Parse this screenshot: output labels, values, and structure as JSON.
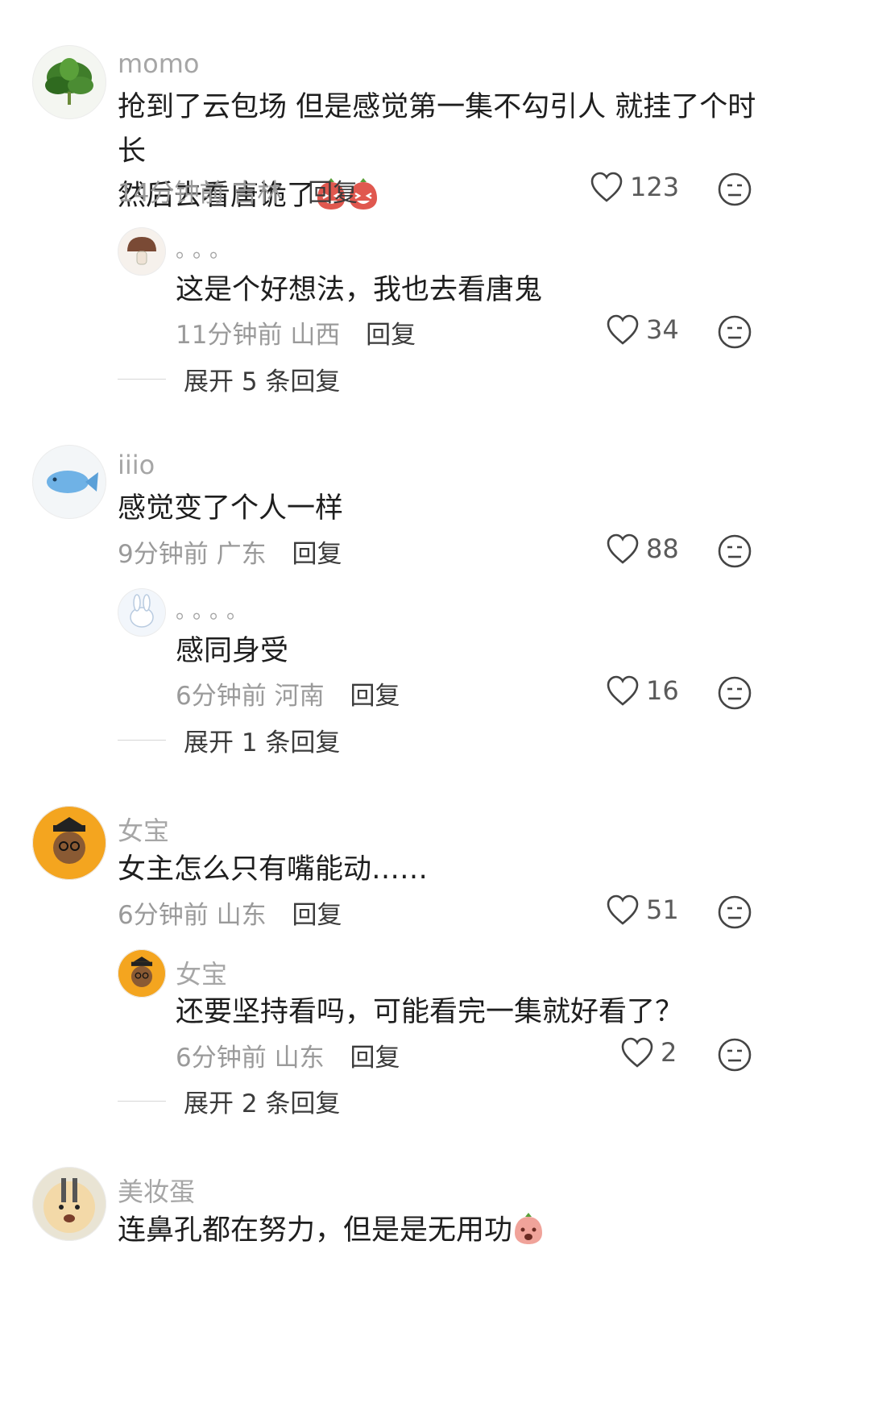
{
  "comments": [
    {
      "user": "momo",
      "text_line1": "抢到了云包场 但是感觉第一集不勾引人 就挂了个时长",
      "text_line2": "然后去看唐诡了",
      "time": "14分钟前",
      "location": "吉林",
      "reply_label": "回复",
      "likes": "123",
      "avatar_icon": "basil-leaf-avatar",
      "reply": {
        "user": "。。。",
        "text": "这是个好想法，我也去看唐鬼",
        "time": "11分钟前",
        "location": "山西",
        "reply_label": "回复",
        "likes": "34",
        "avatar_icon": "mushroom-avatar"
      },
      "expand_label": "展开 5 条回复"
    },
    {
      "user": "iiio",
      "text_line1": "感觉变了个人一样",
      "time": "9分钟前",
      "location": "广东",
      "reply_label": "回复",
      "likes": "88",
      "avatar_icon": "blue-fish-avatar",
      "reply": {
        "user": "。。。。",
        "text": "感同身受",
        "time": "6分钟前",
        "location": "河南",
        "reply_label": "回复",
        "likes": "16",
        "avatar_icon": "white-rabbit-avatar"
      },
      "expand_label": "展开 1 条回复"
    },
    {
      "user": "女宝",
      "text_line1": "女主怎么只有嘴能动……",
      "time": "6分钟前",
      "location": "山东",
      "reply_label": "回复",
      "likes": "51",
      "avatar_icon": "graduate-cartoon-avatar",
      "reply": {
        "user": "女宝",
        "text": "还要坚持看吗，可能看完一集就好看了？",
        "time": "6分钟前",
        "location": "山东",
        "reply_label": "回复",
        "likes": "2",
        "avatar_icon": "graduate-cartoon-avatar"
      },
      "expand_label": "展开 2 条回复"
    },
    {
      "user": "美妆蛋",
      "text_line1": "连鼻孔都在努力，但是是无用功",
      "avatar_icon": "cartoon-face-avatar"
    }
  ],
  "colors": {
    "username": "#a6a6a6",
    "meta": "#9a9a9a",
    "text": "#1e1e1e",
    "emoji_red": "#e0584f"
  }
}
